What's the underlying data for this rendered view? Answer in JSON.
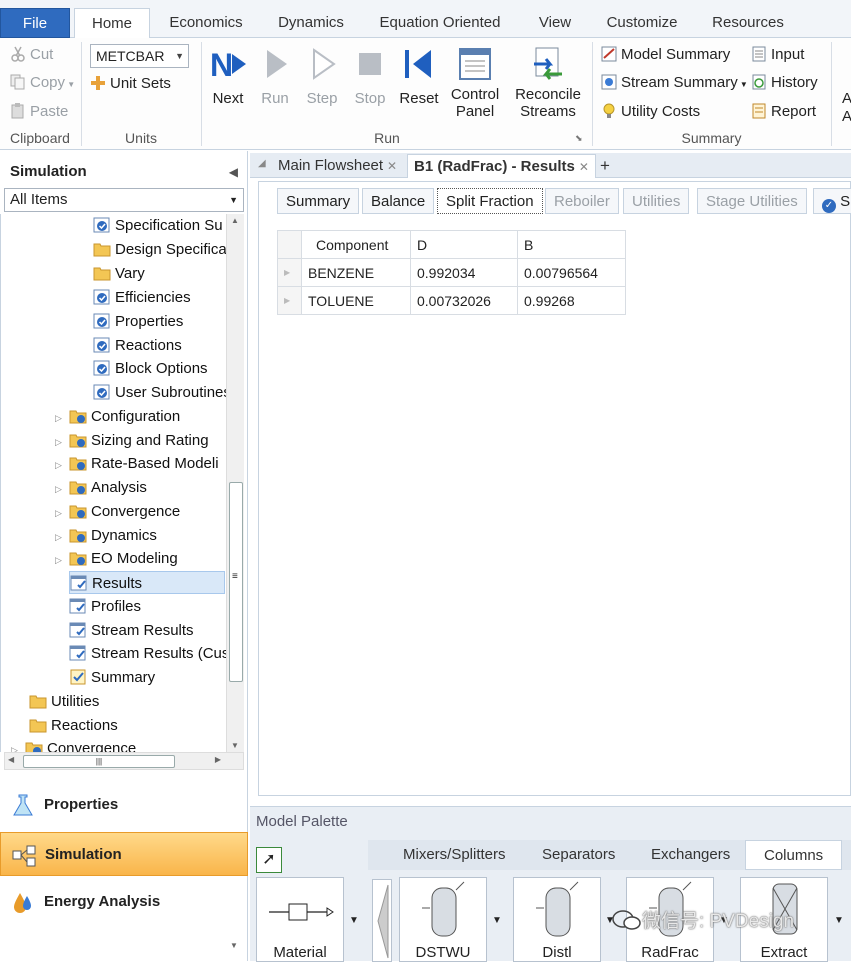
{
  "ribbon_tabs": [
    "File",
    "Home",
    "Economics",
    "Dynamics",
    "Equation Oriented",
    "View",
    "Customize",
    "Resources"
  ],
  "clipboard": {
    "cut": "Cut",
    "copy": "Copy",
    "paste": "Paste",
    "label": "Clipboard"
  },
  "units": {
    "selected": "METCBAR",
    "unit_sets": "Unit Sets",
    "label": "Units"
  },
  "run": {
    "next": "Next",
    "run": "Run",
    "step": "Step",
    "stop": "Stop",
    "reset": "Reset",
    "control_panel_1": "Control",
    "control_panel_2": "Panel",
    "reconcile_1": "Reconcile",
    "reconcile_2": "Streams",
    "label": "Run"
  },
  "summary": {
    "model_summary": "Model Summary",
    "stream_summary": "Stream Summary",
    "utility_costs": "Utility Costs",
    "input": "Input",
    "history": "History",
    "report": "Report",
    "label": "Summary",
    "clipped_a": "A",
    "clipped_b": "A"
  },
  "nav": {
    "header": "Simulation",
    "filter": "All Items",
    "tree": [
      "Specification Su",
      "Design Specifica",
      "Vary",
      "Efficiencies",
      "Properties",
      "Reactions",
      "Block Options",
      "User Subroutines",
      "Configuration",
      "Sizing and Rating",
      "Rate-Based Modeli",
      "Analysis",
      "Convergence",
      "Dynamics",
      "EO Modeling",
      "Results",
      "Profiles",
      "Stream Results",
      "Stream Results (Cus",
      "Summary",
      "Utilities",
      "Reactions",
      "Convergence"
    ],
    "bottom": [
      "Properties",
      "Simulation",
      "Energy Analysis"
    ]
  },
  "editor_tabs": {
    "main": "Main Flowsheet",
    "b1": "B1 (RadFrac) - Results"
  },
  "form_tabs": [
    "Summary",
    "Balance",
    "Split Fraction",
    "Reboiler",
    "Utilities",
    "Stage Utilities",
    "S"
  ],
  "table": {
    "headers": [
      "Component",
      "D",
      "B"
    ],
    "rows": [
      [
        "BENZENE",
        "0.992034",
        "0.00796564"
      ],
      [
        "TOLUENE",
        "0.00732026",
        "0.99268"
      ]
    ]
  },
  "palette": {
    "title": "Model Palette",
    "tabs": [
      "Mixers/Splitters",
      "Separators",
      "Exchangers",
      "Columns"
    ],
    "items": [
      "Material",
      "DSTWU",
      "Distl",
      "RadFrac",
      "Extract"
    ]
  },
  "watermark": "微信号: PVDesign",
  "colors": {
    "file_tab": "#2f6bbf",
    "active_nav": "#f9b54a",
    "accent": "#1f5fbf"
  }
}
